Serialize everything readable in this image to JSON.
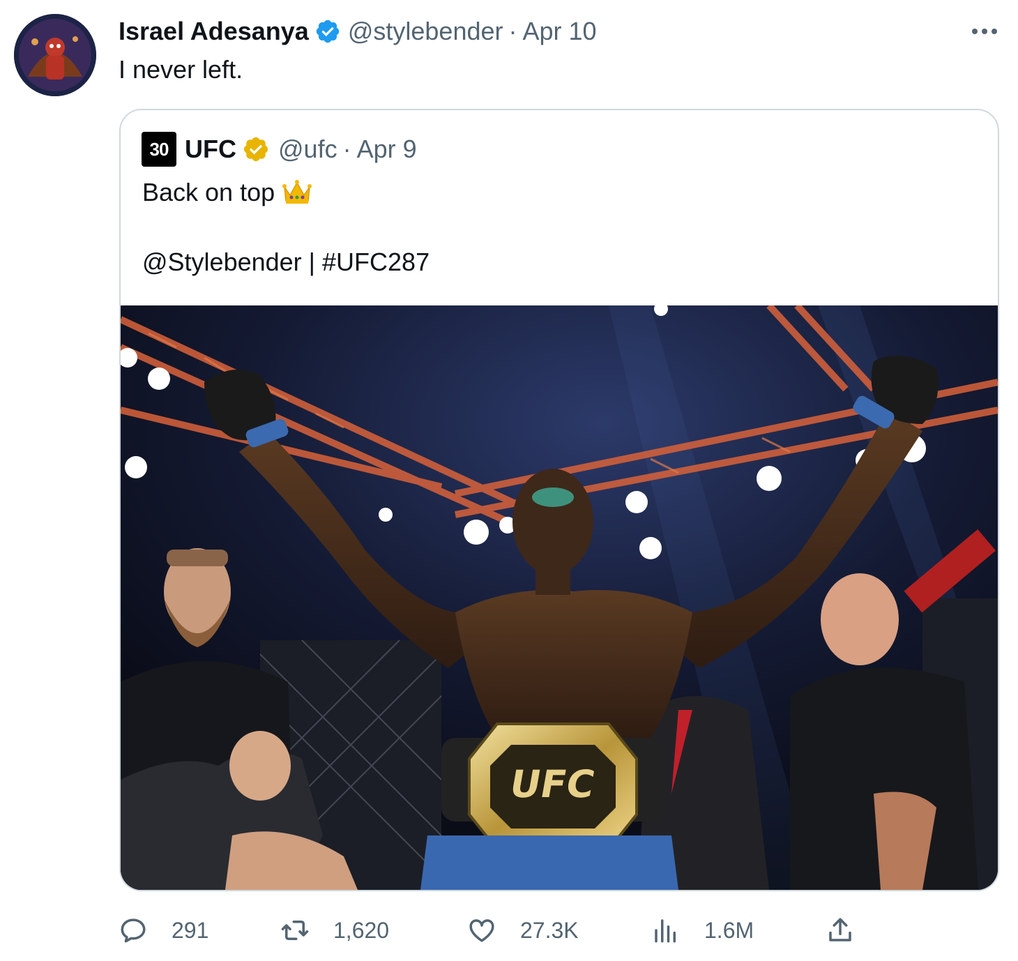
{
  "author": {
    "name": "Israel Adesanya",
    "handle": "@stylebender",
    "separator": "·",
    "date": "Apr 10",
    "avatar_icon": "avatar-image",
    "verified_color": "#1d9bf0"
  },
  "tweet": {
    "text": "I never left."
  },
  "quoted": {
    "logo_text": "30",
    "name": "UFC",
    "handle": "@ufc",
    "separator": "·",
    "date": "Apr 9",
    "verified_color": "#e8b400",
    "line1": "Back on top",
    "line2": "@Stylebender | #UFC287",
    "emoji": "crown-emoji",
    "photo_icon": "photo-fighter-with-belt"
  },
  "actions": {
    "replies": "291",
    "retweets": "1,620",
    "likes": "27.3K",
    "views": "1.6M"
  },
  "colors": {
    "text": "#0f1419",
    "secondary": "#536471",
    "border": "#cfd9de"
  }
}
